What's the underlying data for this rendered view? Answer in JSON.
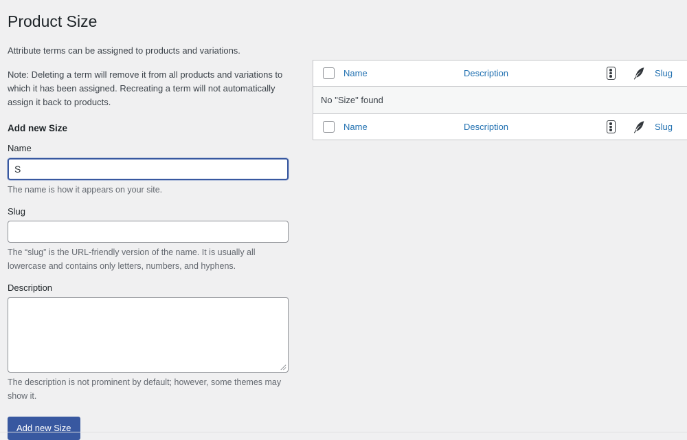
{
  "page": {
    "title": "Product Size",
    "intro": "Attribute terms can be assigned to products and variations.",
    "note": "Note: Deleting a term will remove it from all products and variations to which it has been assigned. Recreating a term will not automatically assign it back to products.",
    "accent_link_color": "#2271b1",
    "button_color": "#3858a0",
    "background_color": "#f0f0f1"
  },
  "form": {
    "heading": "Add new Size",
    "name": {
      "label": "Name",
      "value": "S",
      "placeholder": "",
      "helper": "The name is how it appears on your site.",
      "focused": true
    },
    "slug": {
      "label": "Slug",
      "value": "",
      "placeholder": "",
      "helper": "The “slug” is the URL-friendly version of the name. It is usually all lowercase and contains only letters, numbers, and hyphens."
    },
    "description": {
      "label": "Description",
      "value": "",
      "placeholder": "",
      "helper": "The description is not prominent by default; however, some themes may show it."
    },
    "submit_label": "Add new Size"
  },
  "table": {
    "columns": {
      "name": "Name",
      "description": "Description",
      "count_icon": "count-icon",
      "quill_icon": "quill-icon",
      "slug": "Slug"
    },
    "select_all_checked": false,
    "empty_message": "No \"Size\" found",
    "rows": []
  }
}
